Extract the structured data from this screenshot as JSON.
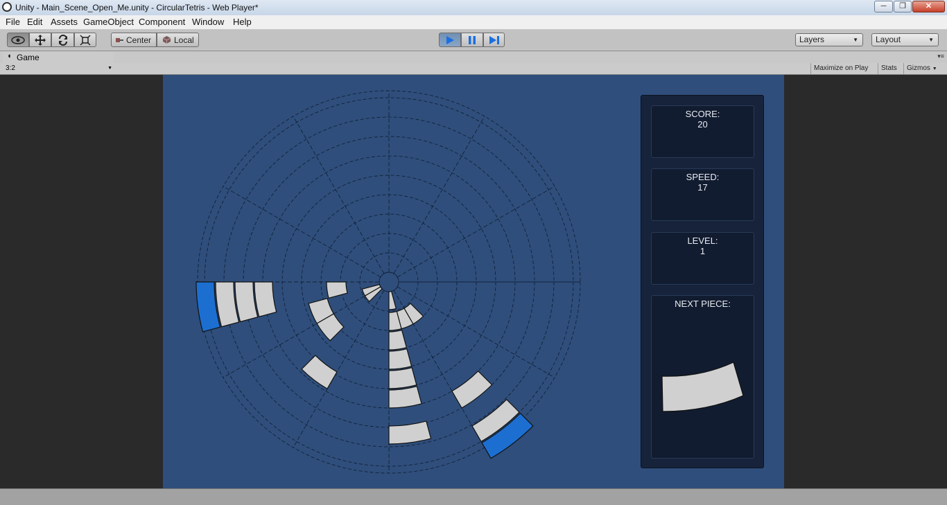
{
  "window": {
    "title": "Unity - Main_Scene_Open_Me.unity - CircularTetris - Web Player*",
    "minimize": "─",
    "restore": "❐",
    "close": "✕"
  },
  "menu": [
    "File",
    "Edit",
    "Assets",
    "GameObject",
    "Component",
    "Window",
    "Help"
  ],
  "toolbar": {
    "pivot_label": "Center",
    "space_label": "Local",
    "layers_label": "Layers",
    "layout_label": "Layout"
  },
  "game_view": {
    "tab_label": "Game",
    "aspect": "3:2",
    "maximize_on_play": "Maximize on Play",
    "stats": "Stats",
    "gizmos": "Gizmos"
  },
  "hud": {
    "score_label": "SCORE:",
    "score_value": "20",
    "speed_label": "SPEED:",
    "speed_value": "17",
    "level_label": "LEVEL:",
    "level_value": "1",
    "next_label": "NEXT PIECE:"
  },
  "colors": {
    "background": "#2f4e7b",
    "block": "#d0d0d0",
    "active_block": "#1c6fd1",
    "panel": "#16233a"
  }
}
